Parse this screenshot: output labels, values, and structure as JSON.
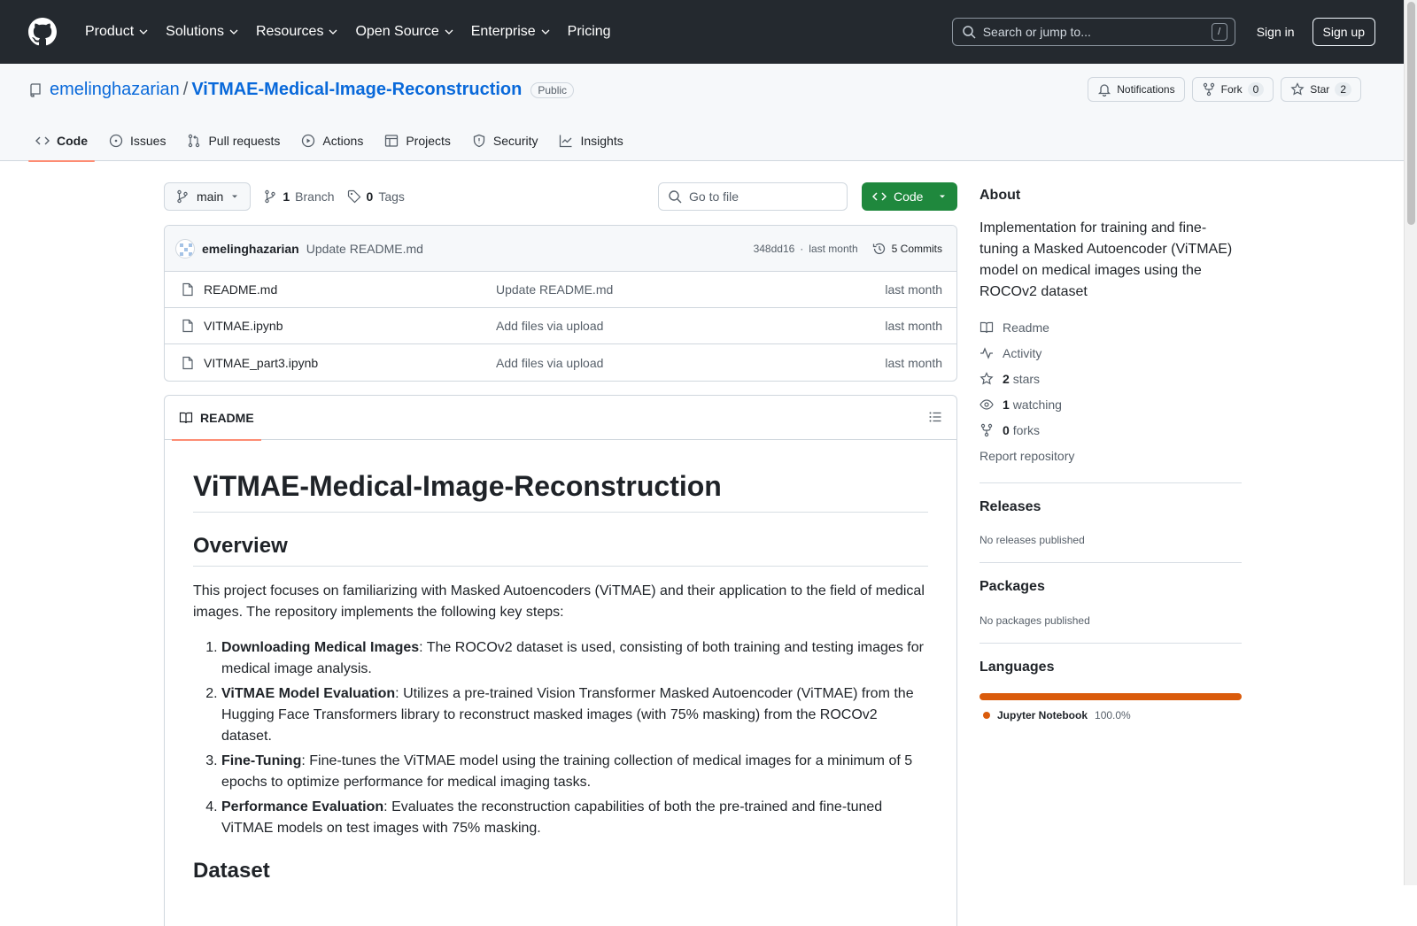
{
  "header": {
    "nav": [
      {
        "label": "Product",
        "has_menu": true
      },
      {
        "label": "Solutions",
        "has_menu": true
      },
      {
        "label": "Resources",
        "has_menu": true
      },
      {
        "label": "Open Source",
        "has_menu": true
      },
      {
        "label": "Enterprise",
        "has_menu": true
      },
      {
        "label": "Pricing",
        "has_menu": false
      }
    ],
    "search_placeholder": "Search or jump to...",
    "search_shortcut": "/",
    "sign_in": "Sign in",
    "sign_up": "Sign up"
  },
  "repo": {
    "owner": "emelinghazarian",
    "separator": "/",
    "name": "ViTMAE-Medical-Image-Reconstruction",
    "visibility": "Public",
    "notifications_label": "Notifications",
    "fork_label": "Fork",
    "fork_count": "0",
    "star_label": "Star",
    "star_count": "2",
    "tabs": [
      {
        "label": "Code",
        "icon": "code-icon",
        "active": true
      },
      {
        "label": "Issues",
        "icon": "issue-icon",
        "active": false
      },
      {
        "label": "Pull requests",
        "icon": "pull-request-icon",
        "active": false
      },
      {
        "label": "Actions",
        "icon": "play-icon",
        "active": false
      },
      {
        "label": "Projects",
        "icon": "table-icon",
        "active": false
      },
      {
        "label": "Security",
        "icon": "shield-icon",
        "active": false
      },
      {
        "label": "Insights",
        "icon": "graph-icon",
        "active": false
      }
    ]
  },
  "toolbar": {
    "branch": "main",
    "branch_count": "1",
    "branch_label": "Branch",
    "tag_count": "0",
    "tag_label": "Tags",
    "goto_placeholder": "Go to file",
    "code_button": "Code"
  },
  "latest_commit": {
    "author": "emelinghazarian",
    "message": "Update README.md",
    "sha": "348dd16",
    "dot": "·",
    "time": "last month",
    "commits_label": "5 Commits"
  },
  "files": [
    {
      "name": "README.md",
      "commit": "Update README.md",
      "date": "last month"
    },
    {
      "name": "VITMAE.ipynb",
      "commit": "Add files via upload",
      "date": "last month"
    },
    {
      "name": "VITMAE_part3.ipynb",
      "commit": "Add files via upload",
      "date": "last month"
    }
  ],
  "readme": {
    "tab_label": "README",
    "title": "ViTMAE-Medical-Image-Reconstruction",
    "overview_heading": "Overview",
    "overview_text": "This project focuses on familiarizing with Masked Autoencoders (ViTMAE) and their application to the field of medical images. The repository implements the following key steps:",
    "steps": [
      {
        "bold": "Downloading Medical Images",
        "text": ": The ROCOv2 dataset is used, consisting of both training and testing images for medical image analysis."
      },
      {
        "bold": "ViTMAE Model Evaluation",
        "text": ": Utilizes a pre-trained Vision Transformer Masked Autoencoder (ViTMAE) from the Hugging Face Transformers library to reconstruct masked images (with 75% masking) from the ROCOv2 dataset."
      },
      {
        "bold": "Fine-Tuning",
        "text": ": Fine-tunes the ViTMAE model using the training collection of medical images for a minimum of 5 epochs to optimize performance for medical imaging tasks."
      },
      {
        "bold": "Performance Evaluation",
        "text": ": Evaluates the reconstruction capabilities of both the pre-trained and fine-tuned ViTMAE models on test images with 75% masking."
      }
    ],
    "dataset_heading": "Dataset"
  },
  "sidebar": {
    "about_heading": "About",
    "description": "Implementation for training and fine-tuning a Masked Autoencoder (ViTMAE) model on medical images using the ROCOv2 dataset",
    "readme_link": "Readme",
    "activity_link": "Activity",
    "stars_count": "2",
    "stars_label": "stars",
    "watching_count": "1",
    "watching_label": "watching",
    "forks_count": "0",
    "forks_label": "forks",
    "report_link": "Report repository",
    "releases_heading": "Releases",
    "releases_text": "No releases published",
    "packages_heading": "Packages",
    "packages_text": "No packages published",
    "languages_heading": "Languages",
    "language_name": "Jupyter Notebook",
    "language_pct": "100.0%",
    "language_color": "#DA5B0B"
  }
}
